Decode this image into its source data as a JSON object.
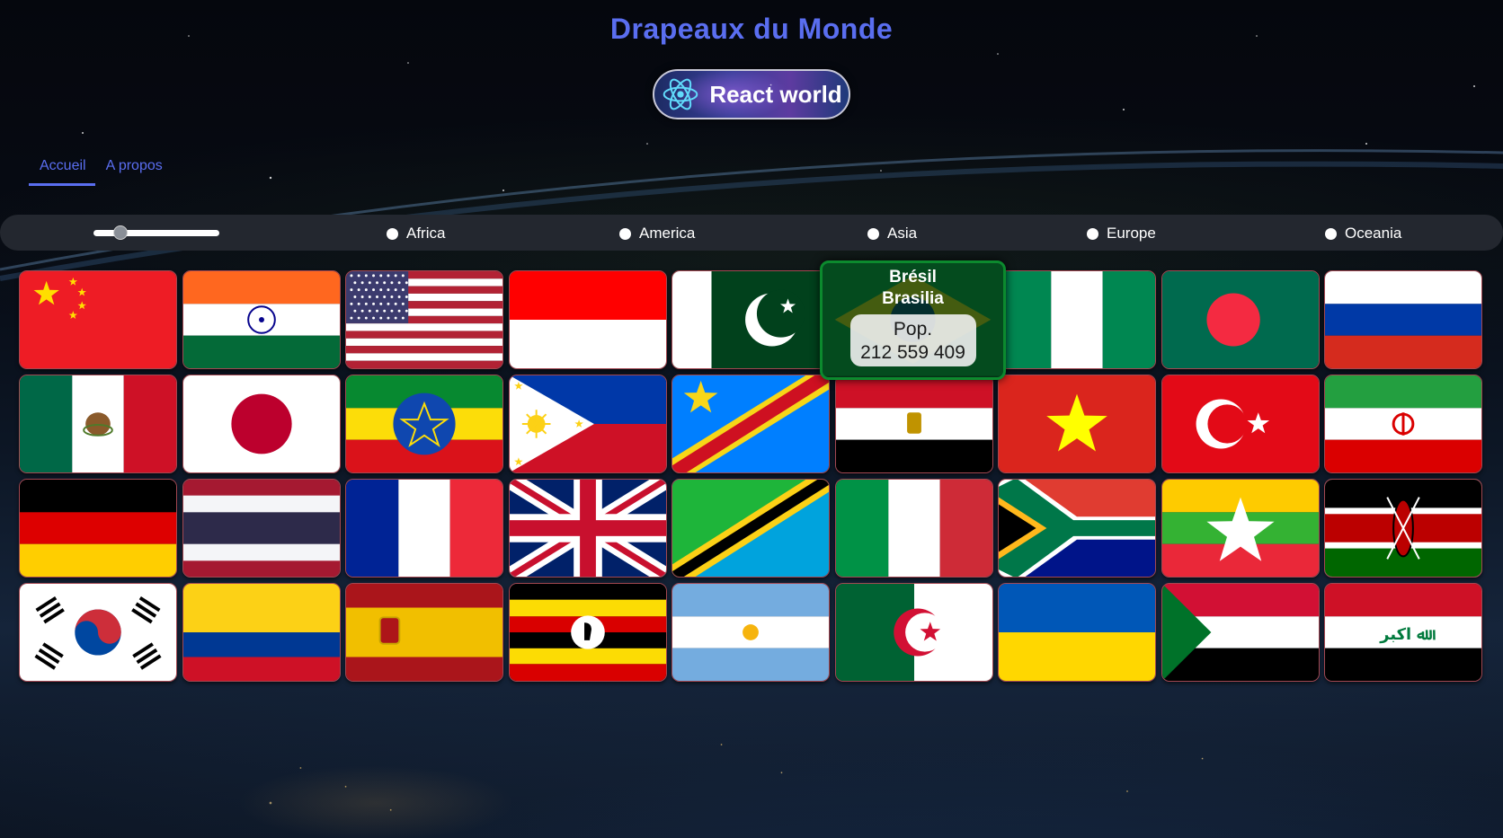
{
  "header": {
    "title": "Drapeaux du Monde",
    "logo_label": "React world"
  },
  "nav": {
    "items": [
      {
        "label": "Accueil",
        "active": true
      },
      {
        "label": "A propos",
        "active": false
      }
    ]
  },
  "filters": {
    "range_value_fraction": 0.18,
    "regions": [
      "Africa",
      "America",
      "Asia",
      "Europe",
      "Oceania"
    ],
    "selected_region": null
  },
  "flags": [
    "china",
    "india",
    "usa",
    "indonesia",
    "pakistan",
    "brazil",
    "nigeria",
    "bangladesh",
    "russia",
    "mexico",
    "japan",
    "ethiopia",
    "philippines",
    "dr-congo",
    "egypt",
    "vietnam",
    "turkey",
    "iran",
    "germany",
    "thailand",
    "france",
    "united-kingdom",
    "tanzania",
    "italy",
    "south-africa",
    "myanmar",
    "kenya",
    "south-korea",
    "colombia",
    "spain",
    "uganda",
    "argentina",
    "algeria",
    "ukraine",
    "sudan",
    "iraq"
  ],
  "hover_card": {
    "country": "Brésil",
    "capital": "Brasilia",
    "pop_label": "Pop.",
    "population": "212 559 409"
  },
  "colors": {
    "accent": "#5a6ef0",
    "filter_bar": "#23272f",
    "hover_bg": "#063016",
    "hover_border": "#0c8a2e"
  }
}
